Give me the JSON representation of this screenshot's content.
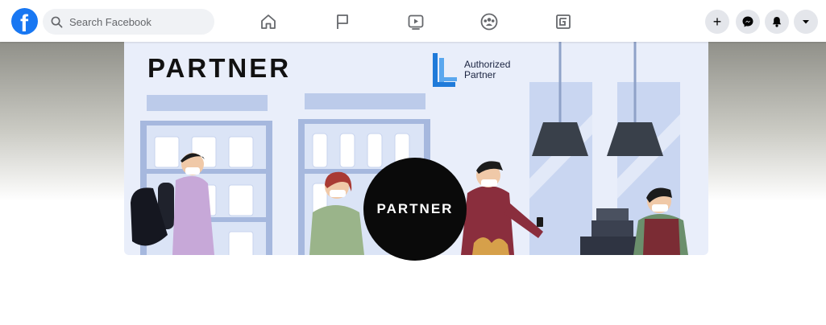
{
  "topbar": {
    "logo_letter": "f",
    "search": {
      "placeholder": "Search Facebook"
    },
    "nav": [
      {
        "id": "home",
        "icon": "home-icon"
      },
      {
        "id": "pages",
        "icon": "flag-icon"
      },
      {
        "id": "watch",
        "icon": "video-icon"
      },
      {
        "id": "groups",
        "icon": "groups-icon"
      },
      {
        "id": "gaming",
        "icon": "gaming-icon"
      }
    ],
    "actions": [
      {
        "id": "create",
        "icon": "plus-icon",
        "glyph": "+"
      },
      {
        "id": "messenger",
        "icon": "messenger-icon"
      },
      {
        "id": "notifications",
        "icon": "bell-icon"
      },
      {
        "id": "account",
        "icon": "caret-down-icon"
      }
    ]
  },
  "cover": {
    "headline": "PARTNER",
    "authorized_text": "Authorized\nPartner",
    "badge_text": "PARTNER",
    "colors": {
      "background": "#e9eefa",
      "shelf": "#bccbea",
      "shelf_dark": "#a6b8de",
      "lamp": "#39404a",
      "badge": "#0a0a0a",
      "brand_blue": "#1877f2"
    }
  }
}
